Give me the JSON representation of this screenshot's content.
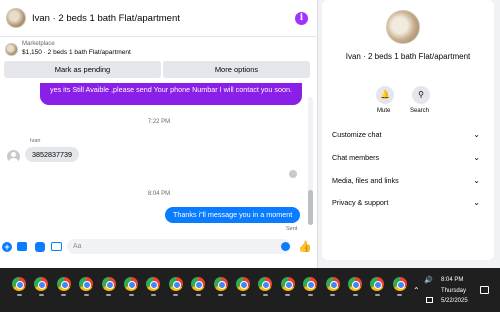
{
  "chat": {
    "title": "Ivan · 2 beds 1 bath Flat/apartment",
    "info_icon": "info-icon",
    "marketplace": {
      "label": "Marketplace",
      "listing": "$1,150 · 2 beds 1 bath Flat/apartment"
    },
    "buttons": {
      "pending": "Mark as pending",
      "more": "More options"
    },
    "messages": {
      "outgoing1": "yes its Still Avaible ,please send Your phone Numbar I will contact you soon.",
      "time1": "7:22 PM",
      "sender": "Ivan",
      "incoming1": "3852837739",
      "time2": "8:04 PM",
      "outgoing2": "Thanks i\"ll message you in a moment",
      "status": "Sent"
    },
    "composer": {
      "placeholder": "Aa"
    }
  },
  "info_panel": {
    "title": "Ivan · 2 beds 1 bath Flat/apartment",
    "actions": [
      {
        "label": "Mute",
        "icon": "bell-icon"
      },
      {
        "label": "Search",
        "icon": "search-icon"
      }
    ],
    "menu": [
      "Customize chat",
      "Chat members",
      "Media, files and links",
      "Privacy & support"
    ]
  },
  "taskbar": {
    "time": "8:04 PM",
    "day": "Thursday",
    "date": "5/22/2025",
    "app_icon": "chrome-icon"
  },
  "colors": {
    "outgoing": "#8a1fe8",
    "outgoing_recent": "#0a7cff",
    "accent": "#0a7cff",
    "info_badge": "#a033ff"
  }
}
